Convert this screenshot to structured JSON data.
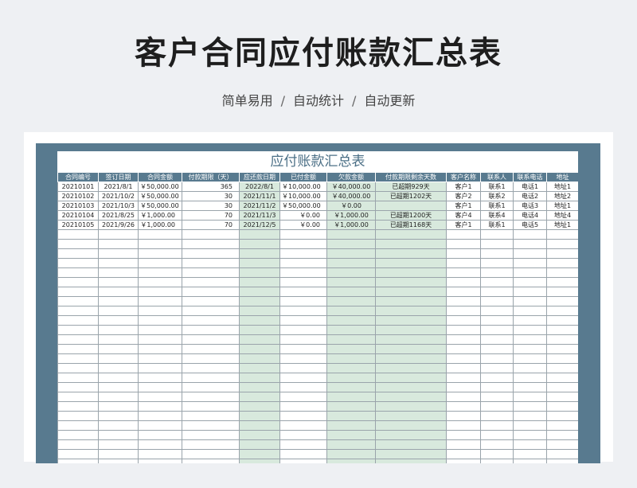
{
  "page": {
    "title": "客户合同应付账款汇总表",
    "subtitle_items": [
      "简单易用",
      "自动统计",
      "自动更新"
    ],
    "separator": "/"
  },
  "sheet": {
    "title": "应付账款汇总表",
    "columns": [
      "合同编号",
      "签订日期",
      "合同金额",
      "付款期限（天）",
      "应还款日期",
      "已付金额",
      "欠款金额",
      "付款期限剩余天数",
      "客户名称",
      "联系人",
      "联系电话",
      "地址"
    ],
    "rows": [
      [
        "20210101",
        "2021/8/1",
        "￥50,000.00",
        "365",
        "2022/8/1",
        "￥10,000.00",
        "￥40,000.00",
        "已超期929天",
        "客户1",
        "联系1",
        "电话1",
        "地址1"
      ],
      [
        "20210102",
        "2021/10/2",
        "￥50,000.00",
        "30",
        "2021/11/1",
        "￥10,000.00",
        "￥40,000.00",
        "已超期1202天",
        "客户2",
        "联系2",
        "电话2",
        "地址2"
      ],
      [
        "20210103",
        "2021/10/3",
        "￥50,000.00",
        "30",
        "2021/11/2",
        "￥50,000.00",
        "￥0.00",
        "",
        "客户1",
        "联系1",
        "电话3",
        "地址1"
      ],
      [
        "20210104",
        "2021/8/25",
        "￥1,000.00",
        "70",
        "2021/11/3",
        "￥0.00",
        "￥1,000.00",
        "已超期1200天",
        "客户4",
        "联系4",
        "电话4",
        "地址4"
      ],
      [
        "20210105",
        "2021/9/26",
        "￥1,000.00",
        "70",
        "2021/12/5",
        "￥0.00",
        "￥1,000.00",
        "已超期1168天",
        "客户1",
        "联系1",
        "电话5",
        "地址1"
      ]
    ],
    "empty_row_count": 26,
    "colors": {
      "header_bg": "#587a8f",
      "highlight_bg": "#d8e9dd",
      "page_bg": "#eef0f3"
    }
  }
}
